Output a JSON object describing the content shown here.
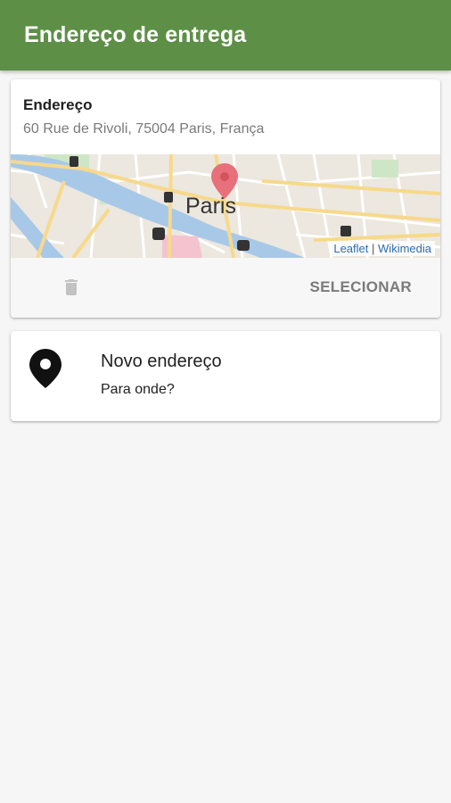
{
  "appbar": {
    "title": "Endereço de entrega"
  },
  "address_card": {
    "title": "Endereço",
    "address": "60 Rue de Rivoli, 75004 Paris, França",
    "map": {
      "city_label": "Paris",
      "attribution": {
        "leaflet": "Leaflet",
        "separator": "|",
        "wikimedia": "Wikimedia"
      }
    },
    "actions": {
      "delete_icon": "trash-icon",
      "select_label": "SELECIONAR"
    }
  },
  "new_address_card": {
    "icon": "map-pin-icon",
    "title": "Novo endereço",
    "subtitle": "Para onde?"
  },
  "colors": {
    "appbar": "#5e8f47",
    "background": "#f6f6f6",
    "map_pin": "#e8707a",
    "river": "#a8c8e8"
  }
}
